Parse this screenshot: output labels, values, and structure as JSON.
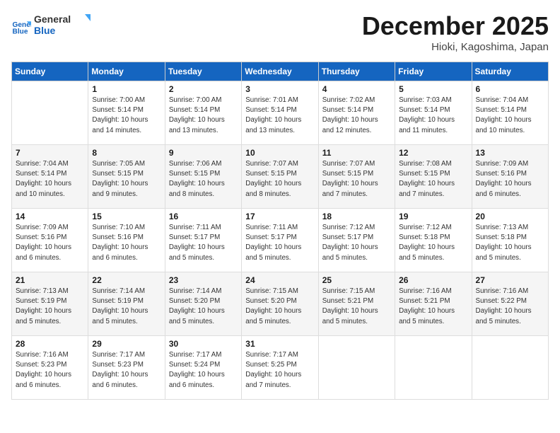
{
  "header": {
    "logo_line1": "General",
    "logo_line2": "Blue",
    "month": "December 2025",
    "location": "Hioki, Kagoshima, Japan"
  },
  "weekdays": [
    "Sunday",
    "Monday",
    "Tuesday",
    "Wednesday",
    "Thursday",
    "Friday",
    "Saturday"
  ],
  "weeks": [
    [
      {
        "day": "",
        "info": ""
      },
      {
        "day": "1",
        "info": "Sunrise: 7:00 AM\nSunset: 5:14 PM\nDaylight: 10 hours\nand 14 minutes."
      },
      {
        "day": "2",
        "info": "Sunrise: 7:00 AM\nSunset: 5:14 PM\nDaylight: 10 hours\nand 13 minutes."
      },
      {
        "day": "3",
        "info": "Sunrise: 7:01 AM\nSunset: 5:14 PM\nDaylight: 10 hours\nand 13 minutes."
      },
      {
        "day": "4",
        "info": "Sunrise: 7:02 AM\nSunset: 5:14 PM\nDaylight: 10 hours\nand 12 minutes."
      },
      {
        "day": "5",
        "info": "Sunrise: 7:03 AM\nSunset: 5:14 PM\nDaylight: 10 hours\nand 11 minutes."
      },
      {
        "day": "6",
        "info": "Sunrise: 7:04 AM\nSunset: 5:14 PM\nDaylight: 10 hours\nand 10 minutes."
      }
    ],
    [
      {
        "day": "7",
        "info": "Sunrise: 7:04 AM\nSunset: 5:14 PM\nDaylight: 10 hours\nand 10 minutes."
      },
      {
        "day": "8",
        "info": "Sunrise: 7:05 AM\nSunset: 5:15 PM\nDaylight: 10 hours\nand 9 minutes."
      },
      {
        "day": "9",
        "info": "Sunrise: 7:06 AM\nSunset: 5:15 PM\nDaylight: 10 hours\nand 8 minutes."
      },
      {
        "day": "10",
        "info": "Sunrise: 7:07 AM\nSunset: 5:15 PM\nDaylight: 10 hours\nand 8 minutes."
      },
      {
        "day": "11",
        "info": "Sunrise: 7:07 AM\nSunset: 5:15 PM\nDaylight: 10 hours\nand 7 minutes."
      },
      {
        "day": "12",
        "info": "Sunrise: 7:08 AM\nSunset: 5:15 PM\nDaylight: 10 hours\nand 7 minutes."
      },
      {
        "day": "13",
        "info": "Sunrise: 7:09 AM\nSunset: 5:16 PM\nDaylight: 10 hours\nand 6 minutes."
      }
    ],
    [
      {
        "day": "14",
        "info": "Sunrise: 7:09 AM\nSunset: 5:16 PM\nDaylight: 10 hours\nand 6 minutes."
      },
      {
        "day": "15",
        "info": "Sunrise: 7:10 AM\nSunset: 5:16 PM\nDaylight: 10 hours\nand 6 minutes."
      },
      {
        "day": "16",
        "info": "Sunrise: 7:11 AM\nSunset: 5:17 PM\nDaylight: 10 hours\nand 5 minutes."
      },
      {
        "day": "17",
        "info": "Sunrise: 7:11 AM\nSunset: 5:17 PM\nDaylight: 10 hours\nand 5 minutes."
      },
      {
        "day": "18",
        "info": "Sunrise: 7:12 AM\nSunset: 5:17 PM\nDaylight: 10 hours\nand 5 minutes."
      },
      {
        "day": "19",
        "info": "Sunrise: 7:12 AM\nSunset: 5:18 PM\nDaylight: 10 hours\nand 5 minutes."
      },
      {
        "day": "20",
        "info": "Sunrise: 7:13 AM\nSunset: 5:18 PM\nDaylight: 10 hours\nand 5 minutes."
      }
    ],
    [
      {
        "day": "21",
        "info": "Sunrise: 7:13 AM\nSunset: 5:19 PM\nDaylight: 10 hours\nand 5 minutes."
      },
      {
        "day": "22",
        "info": "Sunrise: 7:14 AM\nSunset: 5:19 PM\nDaylight: 10 hours\nand 5 minutes."
      },
      {
        "day": "23",
        "info": "Sunrise: 7:14 AM\nSunset: 5:20 PM\nDaylight: 10 hours\nand 5 minutes."
      },
      {
        "day": "24",
        "info": "Sunrise: 7:15 AM\nSunset: 5:20 PM\nDaylight: 10 hours\nand 5 minutes."
      },
      {
        "day": "25",
        "info": "Sunrise: 7:15 AM\nSunset: 5:21 PM\nDaylight: 10 hours\nand 5 minutes."
      },
      {
        "day": "26",
        "info": "Sunrise: 7:16 AM\nSunset: 5:21 PM\nDaylight: 10 hours\nand 5 minutes."
      },
      {
        "day": "27",
        "info": "Sunrise: 7:16 AM\nSunset: 5:22 PM\nDaylight: 10 hours\nand 5 minutes."
      }
    ],
    [
      {
        "day": "28",
        "info": "Sunrise: 7:16 AM\nSunset: 5:23 PM\nDaylight: 10 hours\nand 6 minutes."
      },
      {
        "day": "29",
        "info": "Sunrise: 7:17 AM\nSunset: 5:23 PM\nDaylight: 10 hours\nand 6 minutes."
      },
      {
        "day": "30",
        "info": "Sunrise: 7:17 AM\nSunset: 5:24 PM\nDaylight: 10 hours\nand 6 minutes."
      },
      {
        "day": "31",
        "info": "Sunrise: 7:17 AM\nSunset: 5:25 PM\nDaylight: 10 hours\nand 7 minutes."
      },
      {
        "day": "",
        "info": ""
      },
      {
        "day": "",
        "info": ""
      },
      {
        "day": "",
        "info": ""
      }
    ]
  ]
}
